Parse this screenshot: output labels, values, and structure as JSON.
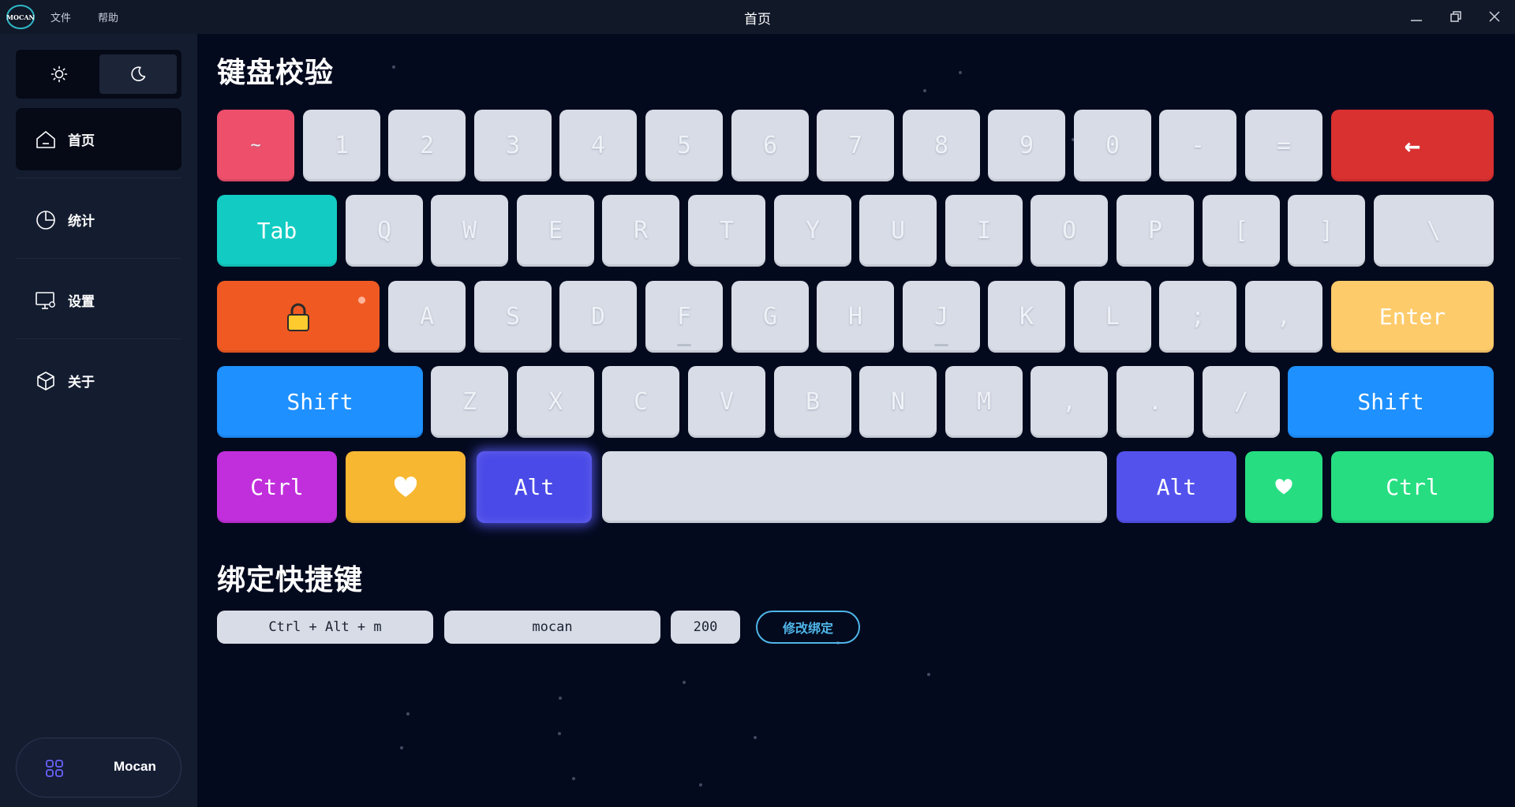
{
  "titlebar": {
    "logo_text": "MOCAN",
    "menu": [
      "文件",
      "帮助"
    ],
    "title": "首页",
    "controls": [
      "minimize-icon",
      "restore-icon",
      "close-icon"
    ]
  },
  "sidebar": {
    "theme": {
      "light": "sun-icon",
      "dark": "moon-icon",
      "selected": "dark"
    },
    "items": [
      {
        "label": "首页",
        "icon": "home-icon",
        "active": true
      },
      {
        "label": "统计",
        "icon": "pie-chart-icon",
        "active": false
      },
      {
        "label": "设置",
        "icon": "monitor-settings-icon",
        "active": false
      },
      {
        "label": "关于",
        "icon": "cube-icon",
        "active": false
      }
    ],
    "user": {
      "name": "Mocan",
      "icon": "apps-icon"
    }
  },
  "main": {
    "keyboard_title": "键盘校验",
    "shortcut_title": "绑定快捷键",
    "keyboard": {
      "row1": [
        "~",
        "1",
        "2",
        "3",
        "4",
        "5",
        "6",
        "7",
        "8",
        "9",
        "0",
        "-",
        "=",
        "←"
      ],
      "row2": [
        "Tab",
        "Q",
        "W",
        "E",
        "R",
        "T",
        "Y",
        "U",
        "I",
        "O",
        "P",
        "[",
        "]",
        "\\"
      ],
      "row3": [
        "lock-icon",
        "A",
        "S",
        "D",
        "F",
        "G",
        "H",
        "J",
        "K",
        "L",
        ";",
        ",",
        "Enter"
      ],
      "row4": [
        "Shift",
        "Z",
        "X",
        "C",
        "V",
        "B",
        "N",
        "M",
        ",",
        ".",
        "/",
        "Shift"
      ],
      "row5": [
        "Ctrl",
        "heart-icon",
        "Alt",
        "",
        "Alt",
        "heart-icon",
        "Ctrl"
      ]
    },
    "shortcut": {
      "keys": "Ctrl + Alt + m",
      "name": "mocan",
      "value": "200",
      "button": "修改绑定"
    }
  },
  "colors": {
    "background": "#040a1e",
    "sidebar": "#141d30",
    "key_default": "#d7dce6",
    "tilde": "#ee4f6b",
    "backspace": "#d93030",
    "tab": "#12ccc3",
    "capslock": "#f05a22",
    "enter": "#fecb6b",
    "shift": "#1e90ff",
    "ctrl_left": "#c12fdc",
    "heart_left": "#f7b731",
    "alt": "#5352ed",
    "heart_right": "#26de81",
    "ctrl_right": "#26de81",
    "accent_button": "#4fb6e8"
  }
}
